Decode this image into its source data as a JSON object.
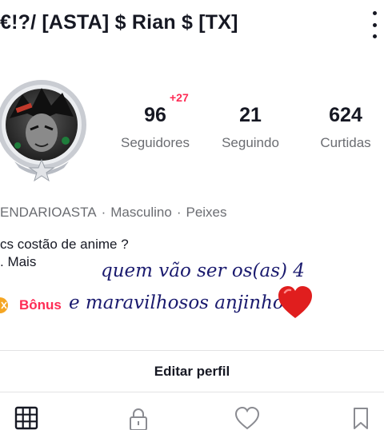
{
  "header": {
    "title": "€!?/ [ASTA] $ Rian $ [TX]",
    "menu_icon": "more-vertical-icon"
  },
  "avatar": {
    "icon": "avatar-image"
  },
  "stats": {
    "followers": {
      "value": "96",
      "label": "Seguidores",
      "badge": "+27"
    },
    "following": {
      "value": "21",
      "label": "Seguindo"
    },
    "likes": {
      "value": "624",
      "label": "Curtidas"
    }
  },
  "meta": {
    "username": "ENDARIOASTA",
    "gender": "Masculino",
    "sign": "Peixes",
    "separator": "·"
  },
  "bio": {
    "line1": "cs costão de anime ?",
    "more": ". Mais"
  },
  "bonus": {
    "label": "Bônus",
    "icon": "bonus-coin-icon"
  },
  "overlay": {
    "line1": "quem vão ser os(as) 4",
    "line2": "e maravilhosos anjinhos?",
    "emoji": "heart-emoji"
  },
  "actions": {
    "edit_profile": "Editar perfil"
  },
  "tabs": [
    {
      "icon": "grid-icon"
    },
    {
      "icon": "lock-icon"
    },
    {
      "icon": "heart-outline-icon"
    },
    {
      "icon": "bookmark-icon"
    }
  ],
  "colors": {
    "accent": "#fe2c55",
    "text": "#161823",
    "muted": "#6b6d72"
  }
}
